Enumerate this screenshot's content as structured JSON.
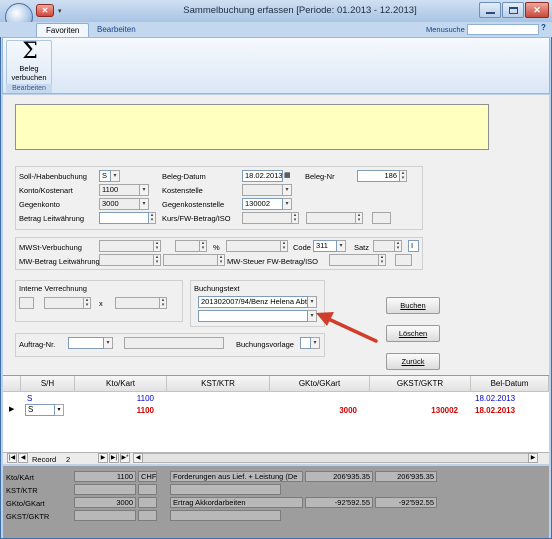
{
  "window": {
    "title": "Sammelbuchung erfassen  [Periode: 01.2013 - 12.2013]",
    "controls": [
      "minimize-icon",
      "maximize-icon",
      "close-icon"
    ]
  },
  "quickaccess": {
    "close_icon": "close-icon"
  },
  "ribbon": {
    "tabs": [
      {
        "label": "Favoriten",
        "active": true
      },
      {
        "label": "Bearbeiten",
        "active": false
      }
    ],
    "menusuche_label": "Menusuche",
    "button_label_1": "Beleg",
    "button_label_2": "verbuchen",
    "group_label": "Bearbeiten",
    "icon": "sigma-icon"
  },
  "form": {
    "soll_haben_label": "Soll-/Habenbuchung",
    "soll_haben_value": "S",
    "konto_label": "Konto/Kostenart",
    "konto_value": "1100",
    "gegenkonto_label": "Gegenkonto",
    "gegenkonto_value": "3000",
    "betrag_label": "Betrag Leitwährung",
    "betrag_value": "",
    "belegdatum_label": "Beleg-Datum",
    "belegdatum_value": "18.02.2013",
    "kostenstelle_label": "Kostenstelle",
    "kostenstelle_value": "",
    "gegenkostenstelle_label": "Gegenkostenstelle",
    "gegenkostenstelle_value": "130002",
    "kurs_label": "Kurs/FW-Betrag/ISO",
    "belegnr_label": "Beleg-Nr",
    "belegnr_value": "186",
    "mwst_label": "MWSt-Verbuchung",
    "mwstbetrag_label": "MW-Betrag Leitwährung",
    "percent": "%",
    "code_label": "Code",
    "code_value": "311",
    "satz_label": "Satz",
    "satz_value": "I",
    "mwsteuer_label": "MW-Steuer FW-Betrag/ISO",
    "interne_label": "Interne Verrechnung",
    "x_label": "x",
    "buchungstext_label": "Buchungstext",
    "buchungstext_value": "201302007/94/Benz Helena Abtw",
    "buchungstext_value2": "",
    "auftrag_label": "Auftrag-Nr.",
    "buchungsvorlage_label": "Buchungsvorlage"
  },
  "buttons": {
    "buchen": "Buchen",
    "loeschen": "Löschen",
    "zurueck": "Zurück"
  },
  "grid": {
    "columns": [
      "S/H",
      "Kto/Kart",
      "KST/KTR",
      "GKto/GKart",
      "GKST/GKTR",
      "Bel-Datum"
    ],
    "rows": [
      {
        "sh": "S",
        "kto": "1100",
        "kst": "",
        "gkto": "",
        "gkst": "",
        "datum": "18.02.2013",
        "style": "blue"
      },
      {
        "sh": "S",
        "kto": "1100",
        "kst": "",
        "gkto": "3000",
        "gkst": "130002",
        "datum": "18.02.2013",
        "style": "red"
      }
    ],
    "record_label": "Record",
    "record_value": "2"
  },
  "totals": {
    "kto_label": "Kto/KArt",
    "kto_value": "1100",
    "currency": "CHF",
    "kto_desc": "Forderungen aus Lief. + Leistung (De",
    "kto_amount1": "206'935.35",
    "kto_amount2": "206'935.35",
    "kst_label": "KST/KTR",
    "gkto_label": "GKto/GKart",
    "gkto_value": "3000",
    "gkto_desc": "Ertrag Akkordarbeiten",
    "gkto_amount1": "-92'592.55",
    "gkto_amount2": "-92'592.55",
    "gkst_label": "GKST/GKTR"
  },
  "colors": {
    "accent_blue": "#0000cc",
    "accent_red": "#d10000",
    "annotation_arrow": "#d23c2a",
    "notice_yellow": "#ffffc0"
  }
}
